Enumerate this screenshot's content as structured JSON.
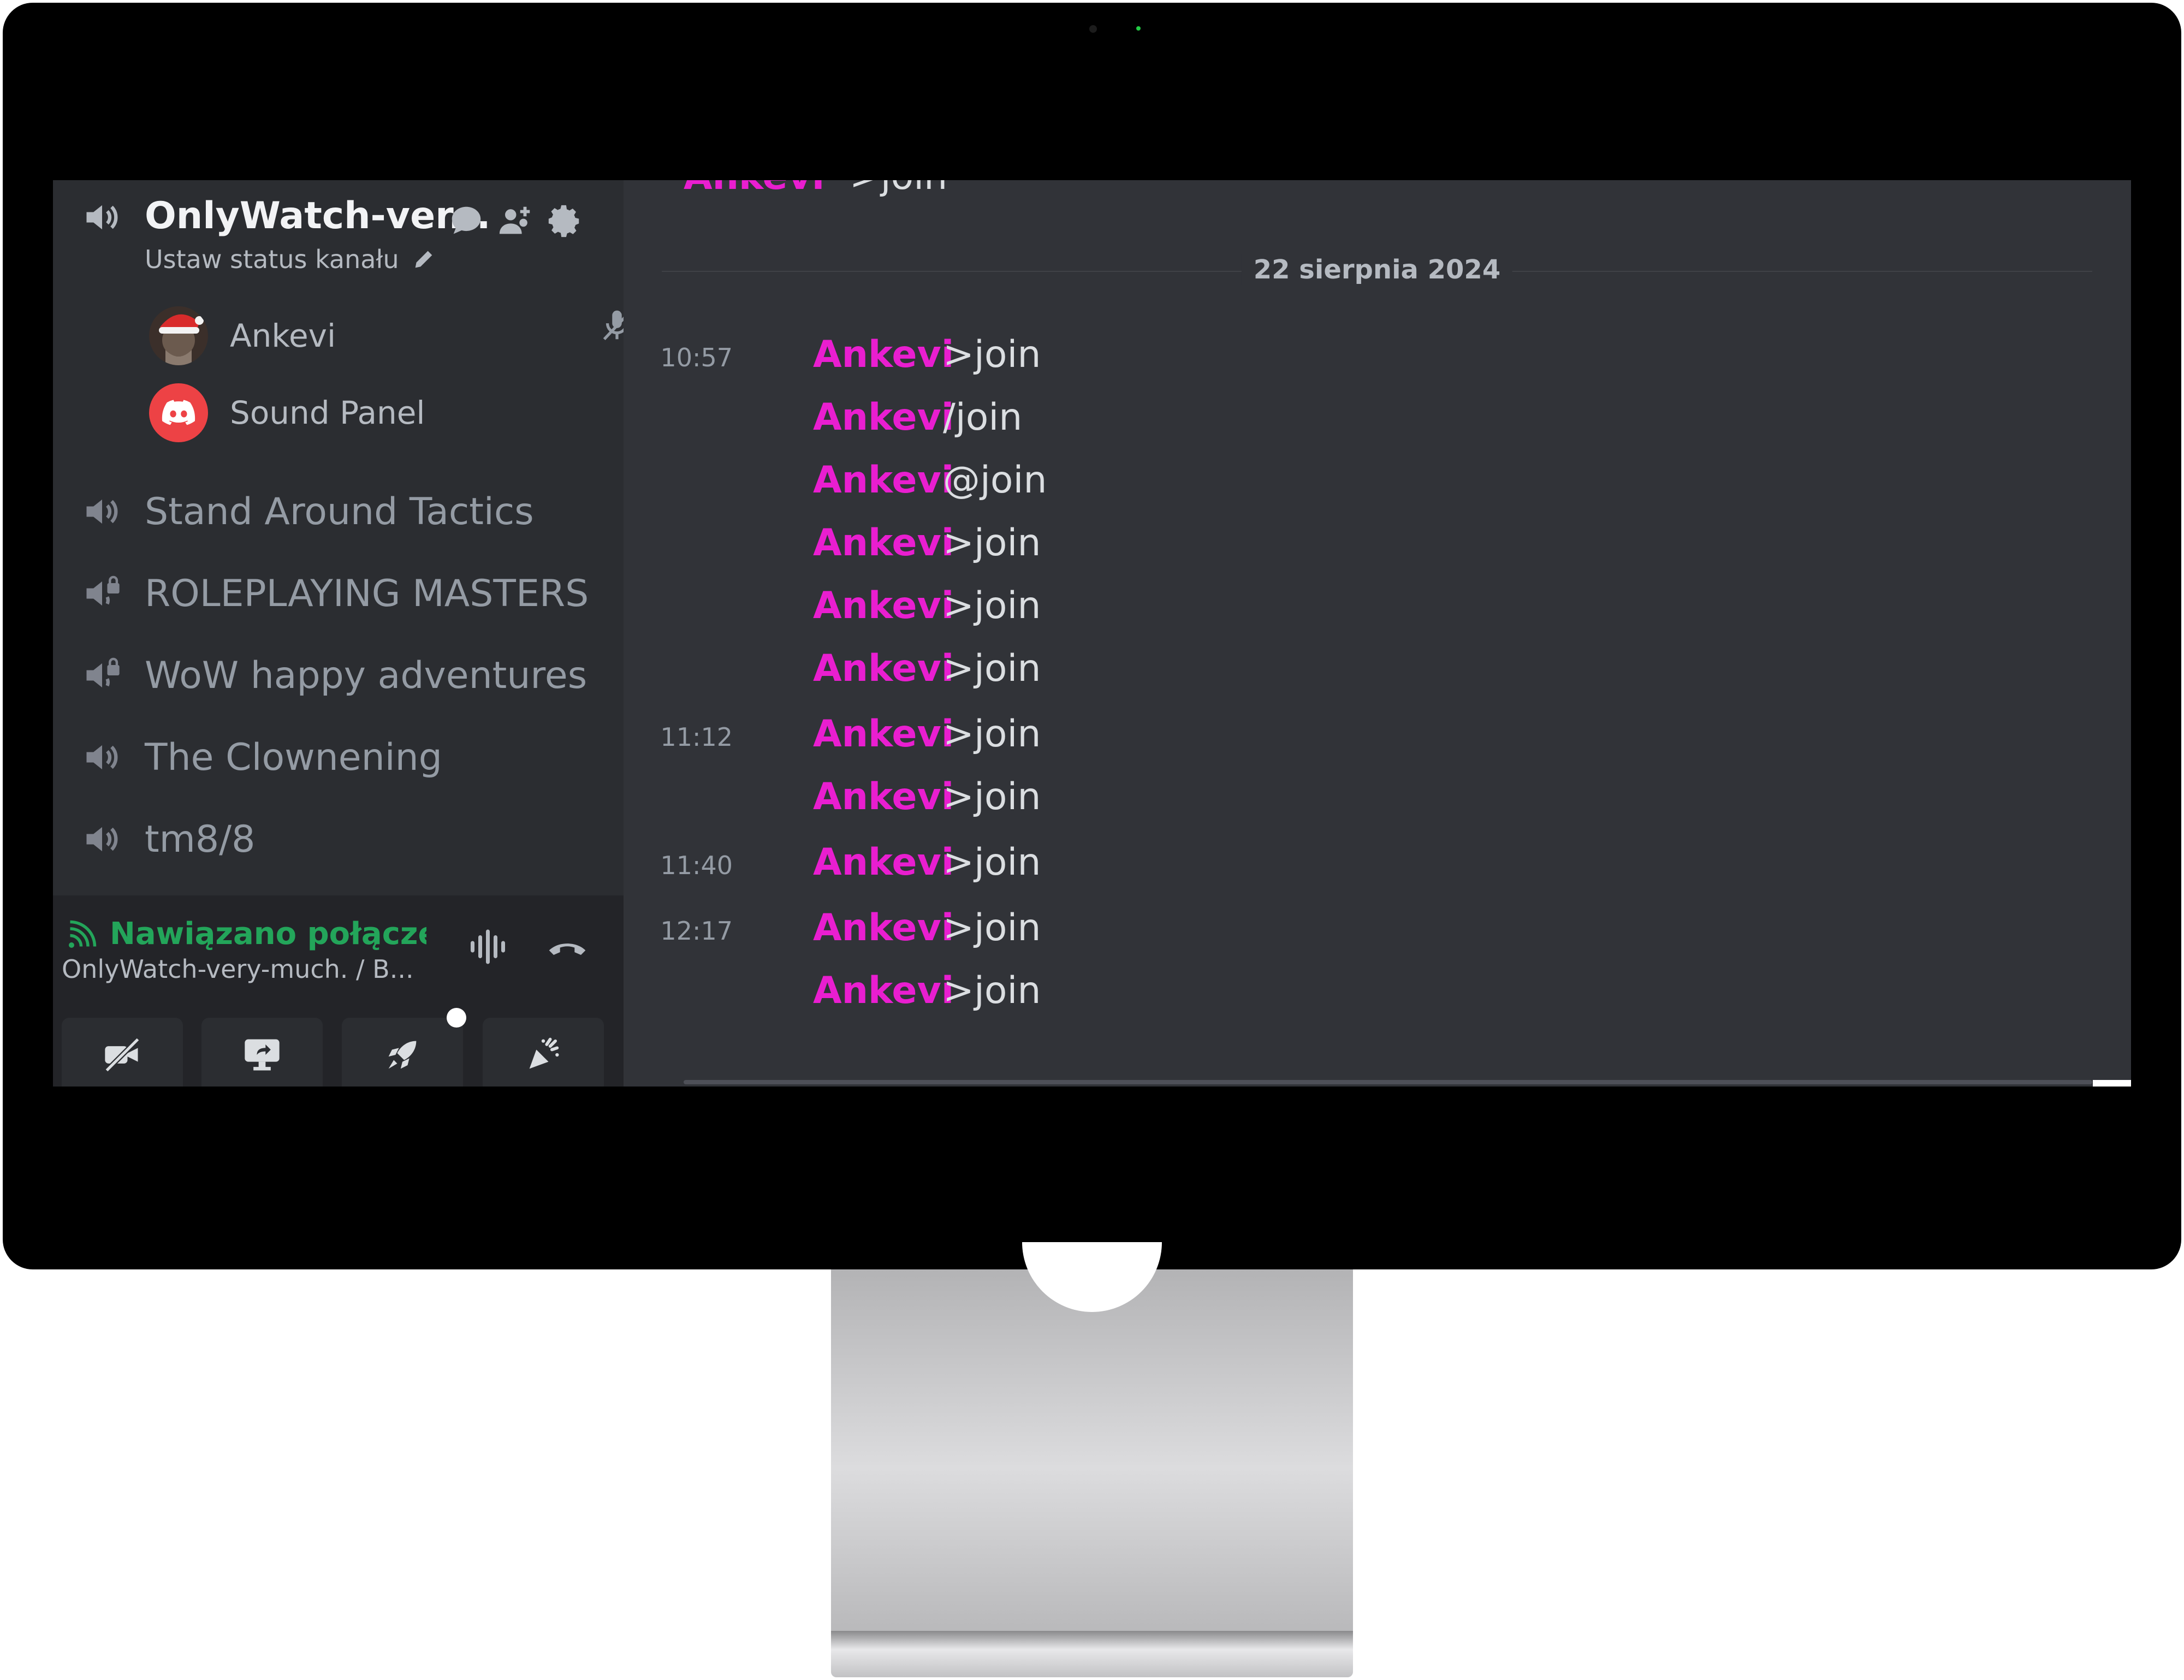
{
  "sidebar": {
    "active_channel": {
      "name": "OnlyWatch-ver...",
      "status_label": "Ustaw status kanału",
      "icons": [
        "speaker-icon",
        "chat-bubble-icon",
        "add-member-icon",
        "gear-icon"
      ]
    },
    "members": [
      {
        "name": "Ankevi",
        "muted": true
      },
      {
        "name": "Sound Panel",
        "muted": false
      }
    ],
    "channels": [
      {
        "name": "Stand Around Tactics",
        "locked": false
      },
      {
        "name": "ROLEPLAYING MASTERS",
        "locked": true
      },
      {
        "name": "WoW happy adventures",
        "locked": true
      },
      {
        "name": "The Clownening",
        "locked": false
      },
      {
        "name": "tm8/8",
        "locked": false
      }
    ],
    "voice_panel": {
      "status": "Nawiązano połączenie",
      "connection": "OnlyWatch-very-much. / B...",
      "colors": {
        "connected": "#23a55a"
      }
    }
  },
  "chat": {
    "date_divider": "22 sierpnia 2024",
    "previous_message": {
      "author": "Ankevi",
      "text": ">join"
    },
    "author_color": "#e91ed0",
    "messages": [
      {
        "time": "10:57",
        "author": "Ankevi",
        "text": ">join"
      },
      {
        "time": "",
        "author": "Ankevi",
        "text": "/join"
      },
      {
        "time": "",
        "author": "Ankevi",
        "text": "@join"
      },
      {
        "time": "",
        "author": "Ankevi",
        "text": ">join"
      },
      {
        "time": "",
        "author": "Ankevi",
        "text": ">join"
      },
      {
        "time": "",
        "author": "Ankevi",
        "text": ">join"
      },
      {
        "time": "11:12",
        "author": "Ankevi",
        "text": ">join"
      },
      {
        "time": "",
        "author": "Ankevi",
        "text": ">join"
      },
      {
        "time": "11:40",
        "author": "Ankevi",
        "text": ">join"
      },
      {
        "time": "12:17",
        "author": "Ankevi",
        "text": ">join"
      },
      {
        "time": "",
        "author": "Ankevi",
        "text": ">join"
      }
    ]
  }
}
